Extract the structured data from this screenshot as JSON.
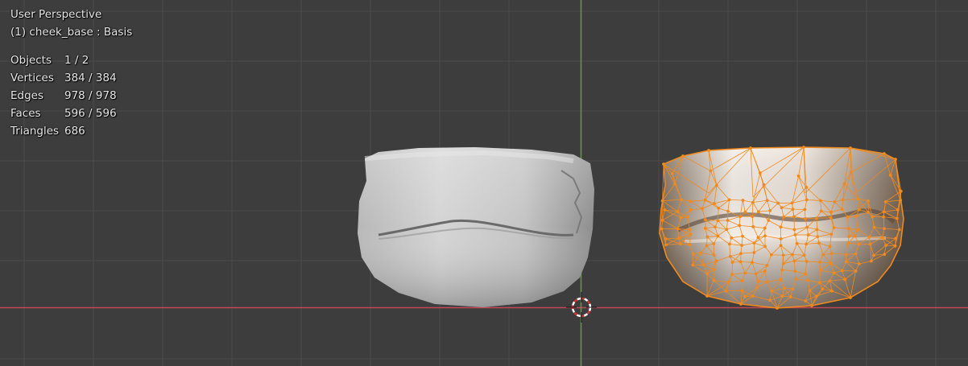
{
  "viewport": {
    "view_name": "User Perspective",
    "object_info": "(1) cheek_base : Basis",
    "stats": [
      {
        "label": "Objects",
        "value": "1 / 2"
      },
      {
        "label": "Vertices",
        "value": "384 / 384"
      },
      {
        "label": "Edges",
        "value": "978 / 978"
      },
      {
        "label": "Faces",
        "value": "596 / 596"
      },
      {
        "label": "Triangles",
        "value": "686"
      }
    ]
  },
  "colors": {
    "background": "#3d3d3d",
    "grid": "#4a4a4a",
    "x_axis": "#bf4a56",
    "y_axis": "#6d9a2d",
    "selection": "#f08a1e",
    "mesh": "#d0d0d0"
  },
  "icons": {
    "cursor": "3d-cursor-icon"
  }
}
